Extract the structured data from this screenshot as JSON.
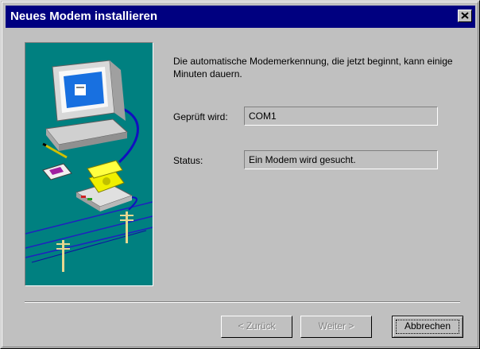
{
  "window": {
    "title": "Neues Modem installieren",
    "close_icon": "close-icon"
  },
  "content": {
    "description": "Die automatische Modemerkennung, die jetzt beginnt, kann einige Minuten dauern.",
    "port_label": "Geprüft wird:",
    "port_value": "COM1",
    "status_label": "Status:",
    "status_value": "Ein Modem wird gesucht."
  },
  "illustration": {
    "icon": "modem-setup-illustration",
    "background": "#008080"
  },
  "buttons": {
    "back": "< Zurück",
    "next": "Weiter >",
    "cancel": "Abbrechen"
  }
}
